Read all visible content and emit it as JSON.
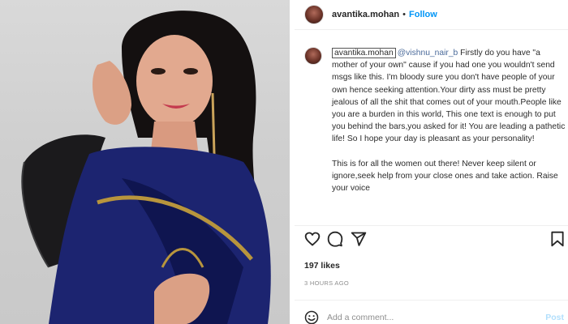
{
  "post": {
    "username": "avantika.mohan",
    "separator": "•",
    "follow_label": "Follow"
  },
  "comment": {
    "username": "avantika.mohan",
    "mention": "@vishnu_nair_b",
    "text1": "Firstly do you have \"a mother of your own\" cause if you had one you wouldn't send msgs like this. I'm bloody sure you don't have people of your own hence seeking attention.Your dirty ass must be pretty jealous of all the shit that comes out of your mouth.People like you are a burden in this world, This one text is enough to put you behind the bars,you asked for it! You are leading a pathetic life! So I hope your day is pleasant as your personality!",
    "text2": "This is for all the women out there! Never keep silent or ignore,seek help from your close ones and take action. Raise your voice"
  },
  "actions": {
    "like_icon": "heart-icon",
    "comment_icon": "comment-icon",
    "share_icon": "share-icon",
    "save_icon": "bookmark-icon"
  },
  "likes": "197 likes",
  "timestamp": "3 HOURS AGO",
  "add_comment": {
    "placeholder": "Add a comment...",
    "post_label": "Post"
  },
  "colors": {
    "follow": "#0095f6",
    "post_disabled": "#b2dffc",
    "muted": "#8e8e8e"
  }
}
